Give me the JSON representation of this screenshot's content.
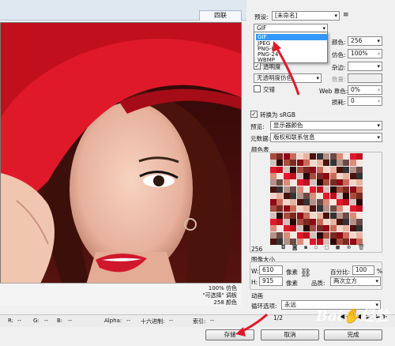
{
  "tabs": {
    "four_up": "四联"
  },
  "preview_info": {
    "line1": "100% 仿色",
    "line2": "\"可选择\" 调板",
    "line3": "258 颜色"
  },
  "bottom_bar": {
    "r": "R:",
    "r_val": "--",
    "g": "G:",
    "g_val": "--",
    "b": "B:",
    "b_val": "--",
    "alpha": "Alpha:",
    "alpha_val": "--",
    "hex": "十六进制:",
    "hex_val": "--",
    "index": "索引:",
    "index_val": "--"
  },
  "settings": {
    "preset_label": "预设:",
    "preset_value": "[未命名]",
    "format_value": "GIF",
    "format_options": [
      "GIF",
      "JPEG",
      "PNG-8",
      "PNG-24",
      "WBMP"
    ],
    "colors_label": "颜色:",
    "colors_value": "256",
    "dither_label": "仿色:",
    "dither_value": "100%",
    "lossy_label": "杂边:",
    "transparency_label": "透明度",
    "transparency_checked": true,
    "no_trans_dither": "无透明度仿色",
    "amount_label": "数量:",
    "interlaced_label": "交错",
    "web_snap_label": "Web 靠色:",
    "web_snap_value": "0%",
    "lossy2_label": "损耗:",
    "lossy2_value": "0",
    "convert_srgb_label": "转换为 sRGB",
    "preview_label": "预览:",
    "preview_value": "显示器颜色",
    "metadata_label": "元数据:",
    "metadata_value": "版权和联系信息"
  },
  "color_table": {
    "title": "颜色表",
    "count": "256"
  },
  "image_size": {
    "title": "图像大小",
    "w_label": "W:",
    "w_value": "610",
    "w_unit": "像素",
    "h_label": "H:",
    "h_value": "915",
    "h_unit": "像素",
    "percent_label": "百分比:",
    "percent_value": "100",
    "percent_unit": "%",
    "quality_label": "品质:",
    "quality_value": "两次立方"
  },
  "animation": {
    "title": "动画",
    "loop_label": "循环选项:",
    "loop_value": "永远",
    "frame_counter": "1/2"
  },
  "buttons": {
    "save": "存储",
    "cancel": "取消",
    "done": "完成"
  },
  "watermark": "Baidu经验",
  "colors": {
    "accent_red": "#e0192a",
    "highlight": "#3399ff"
  }
}
